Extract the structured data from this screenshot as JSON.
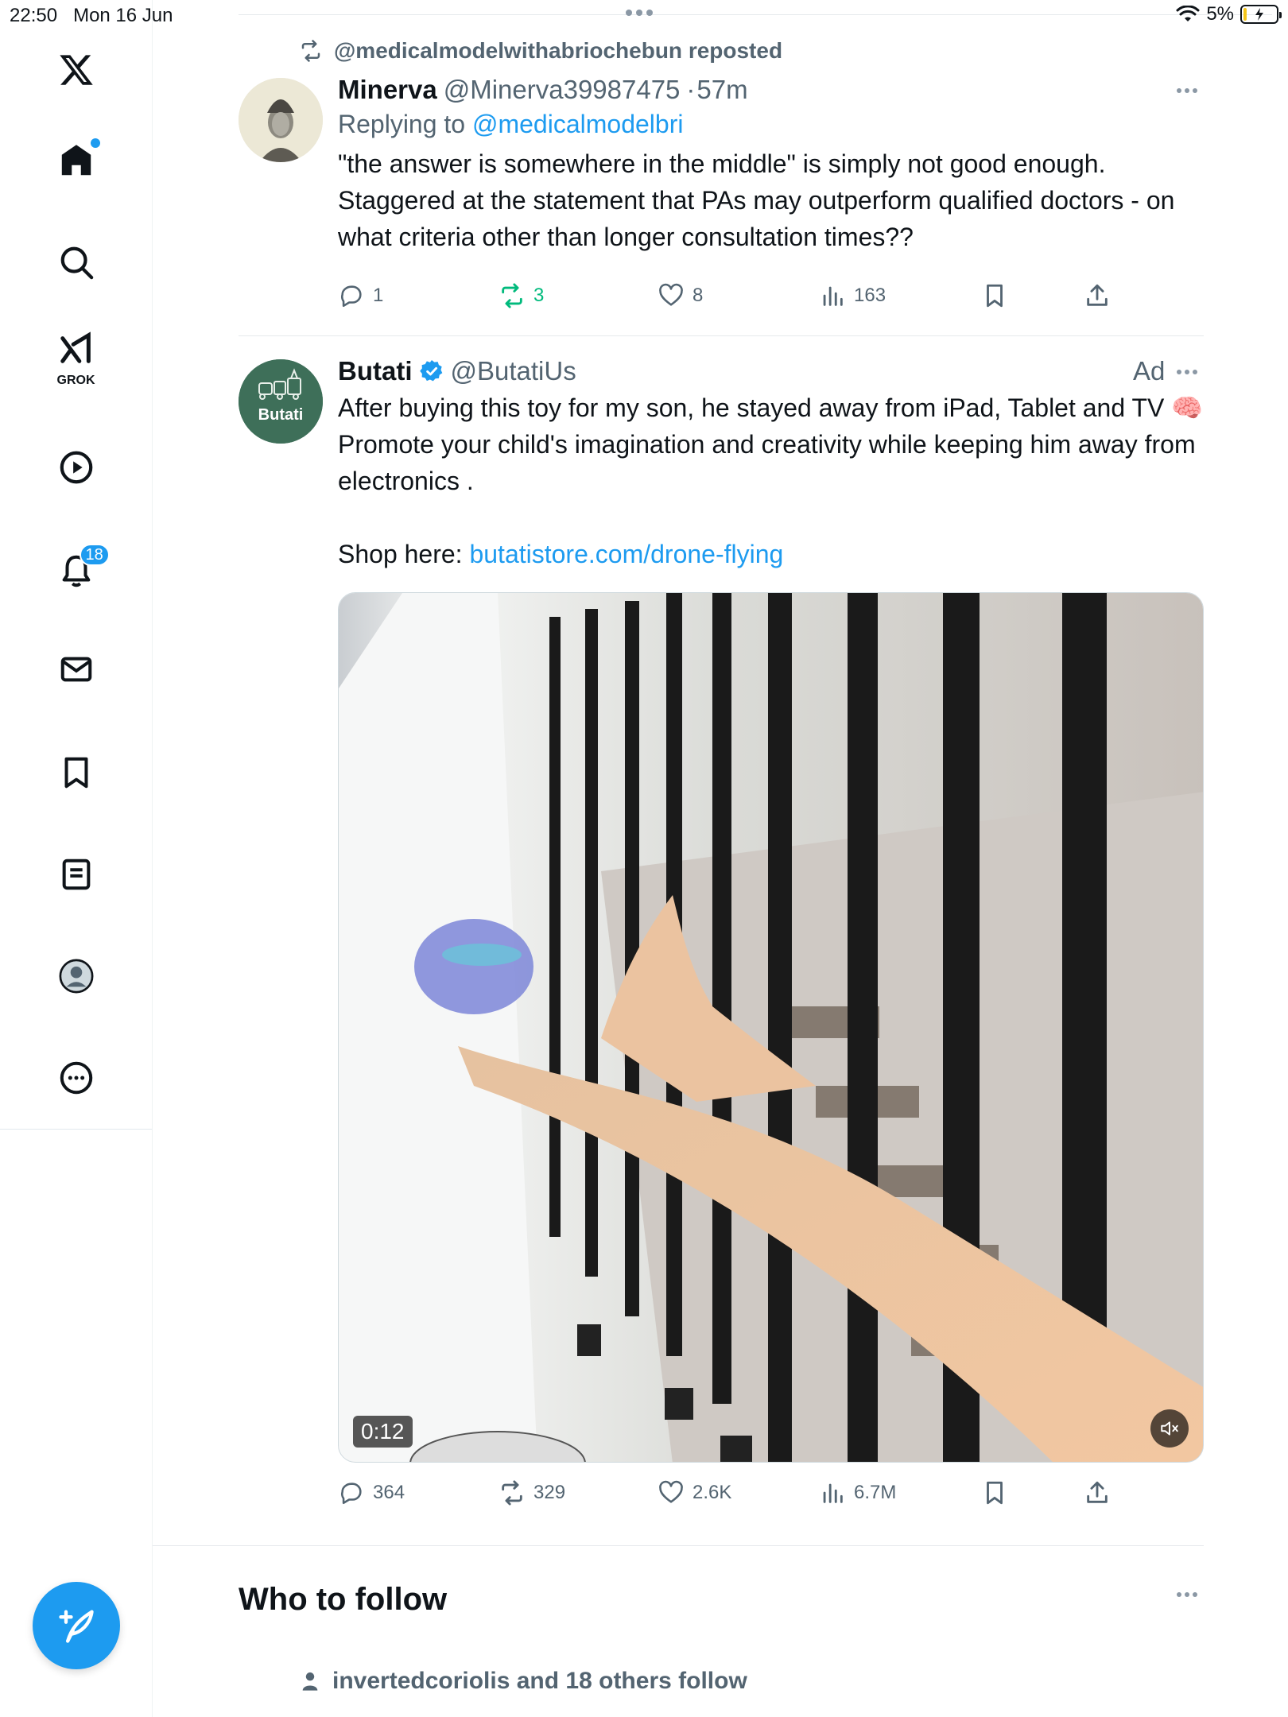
{
  "status_bar": {
    "time": "22:50",
    "date": "Mon 16 Jun",
    "battery": "5%"
  },
  "sidebar": {
    "items": [
      {
        "name": "x-logo",
        "icon": "x-logo-icon"
      },
      {
        "name": "home",
        "icon": "home-icon"
      },
      {
        "name": "explore",
        "icon": "search-icon"
      },
      {
        "name": "grok",
        "icon": "grok-icon",
        "label": "GROK"
      },
      {
        "name": "video",
        "icon": "play-icon"
      },
      {
        "name": "notifications",
        "icon": "bell-icon",
        "badge": "18"
      },
      {
        "name": "messages",
        "icon": "mail-icon"
      },
      {
        "name": "bookmarks",
        "icon": "bookmark-icon"
      },
      {
        "name": "lists",
        "icon": "list-icon"
      },
      {
        "name": "profile",
        "icon": "profile-icon"
      },
      {
        "name": "more",
        "icon": "more-icon"
      }
    ],
    "accent": "#1d9bf0"
  },
  "feed": {
    "tweet1": {
      "repost_text": "@medicalmodelwithabriochebun reposted",
      "name": "Minerva",
      "handle": "@Minerva39987475",
      "separator": "·",
      "time": "57m",
      "replying_prefix": "Replying to",
      "replying_handle": "@medicalmodelbri",
      "text": "\"the answer is somewhere in the middle\" is simply not good enough. Staggered at the statement that PAs may outperform qualified doctors - on what criteria other than longer consultation times??",
      "replies": "1",
      "reposts": "3",
      "likes": "8",
      "views": "163",
      "repost_color": "#00ba7c"
    },
    "tweet2": {
      "name": "Butati",
      "handle": "@ButatiUs",
      "ad_label": "Ad",
      "avatar_text": "Butati",
      "text": "After buying this toy for my son, he stayed away from iPad, Tablet and TV 🧠 Promote your child's imagination and creativity while keeping him away from electronics .",
      "shop_prefix": "Shop here:",
      "shop_link": "butatistore.com/drone-flying",
      "video_duration": "0:12",
      "replies": "364",
      "reposts": "329",
      "likes": "2.6K",
      "views": "6.7M"
    },
    "who_to_follow": {
      "title": "Who to follow",
      "followed_by": "invertedcoriolis and 18 others follow"
    }
  }
}
